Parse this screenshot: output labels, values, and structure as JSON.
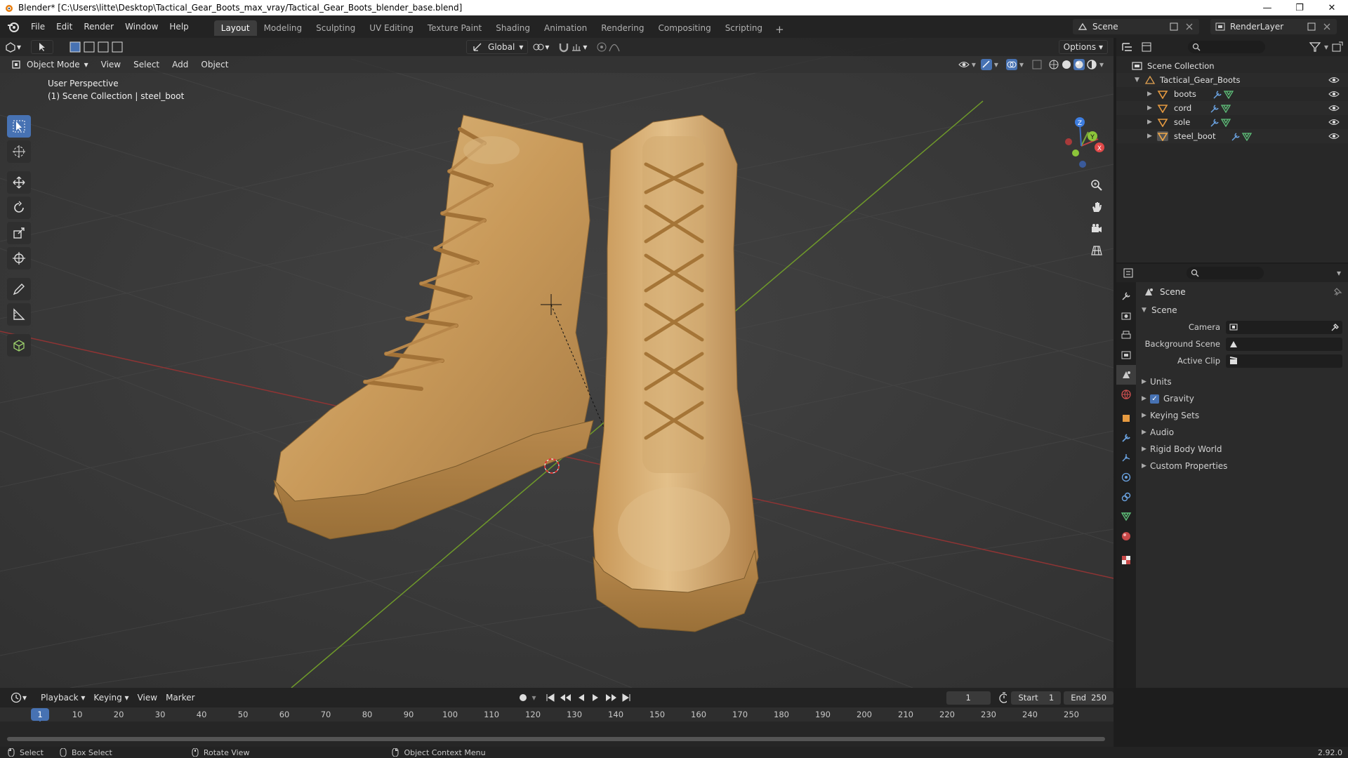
{
  "window": {
    "title": "Blender* [C:\\Users\\litte\\Desktop\\Tactical_Gear_Boots_max_vray/Tactical_Gear_Boots_blender_base.blend]",
    "minimize": "—",
    "restore": "❐",
    "close": "✕"
  },
  "menu": [
    "File",
    "Edit",
    "Render",
    "Window",
    "Help"
  ],
  "workspaces": [
    {
      "label": "Layout",
      "active": true
    },
    {
      "label": "Modeling"
    },
    {
      "label": "Sculpting"
    },
    {
      "label": "UV Editing"
    },
    {
      "label": "Texture Paint"
    },
    {
      "label": "Shading"
    },
    {
      "label": "Animation"
    },
    {
      "label": "Rendering"
    },
    {
      "label": "Compositing"
    },
    {
      "label": "Scripting"
    }
  ],
  "scene_field": "Scene",
  "renderlayer_field": "RenderLayer",
  "viewport": {
    "mode": "Object Mode",
    "menus": [
      "View",
      "Select",
      "Add",
      "Object"
    ],
    "orientation": "Global",
    "options": "Options",
    "info_line1": "User Perspective",
    "info_line2": "(1) Scene Collection | steel_boot",
    "gizmo_x": "X",
    "gizmo_y": "Y",
    "gizmo_z": "Z"
  },
  "outliner": {
    "root": "Scene Collection",
    "collection": "Tactical_Gear_Boots",
    "objects": [
      "boots",
      "cord",
      "sole",
      "steel_boot"
    ]
  },
  "properties": {
    "context": "Scene",
    "panel": "Scene",
    "camera_label": "Camera",
    "bg_scene_label": "Background Scene",
    "active_clip_label": "Active Clip",
    "subpanels": [
      "Units",
      "Gravity",
      "Keying Sets",
      "Audio",
      "Rigid Body World",
      "Custom Properties"
    ]
  },
  "timeline": {
    "menus": [
      "Playback",
      "Keying",
      "View",
      "Marker"
    ],
    "current_frame": "1",
    "start_label": "Start",
    "start_value": "1",
    "end_label": "End",
    "end_value": "250",
    "ticks": [
      "1",
      "10",
      "20",
      "30",
      "40",
      "50",
      "60",
      "70",
      "80",
      "90",
      "100",
      "110",
      "120",
      "130",
      "140",
      "150",
      "160",
      "170",
      "180",
      "190",
      "200",
      "210",
      "220",
      "230",
      "240",
      "250"
    ]
  },
  "status": {
    "select": "Select",
    "box_select": "Box Select",
    "rotate_view": "Rotate View",
    "context_menu": "Object Context Menu",
    "version": "2.92.0"
  },
  "colors": {
    "accent": "#4772b3",
    "grid_bg": "#3a3a3a",
    "x_axis": "#a83a3a",
    "y_axis": "#6f9a2a",
    "boot_light": "#d4a96a",
    "boot_sole": "#b58a4e"
  }
}
